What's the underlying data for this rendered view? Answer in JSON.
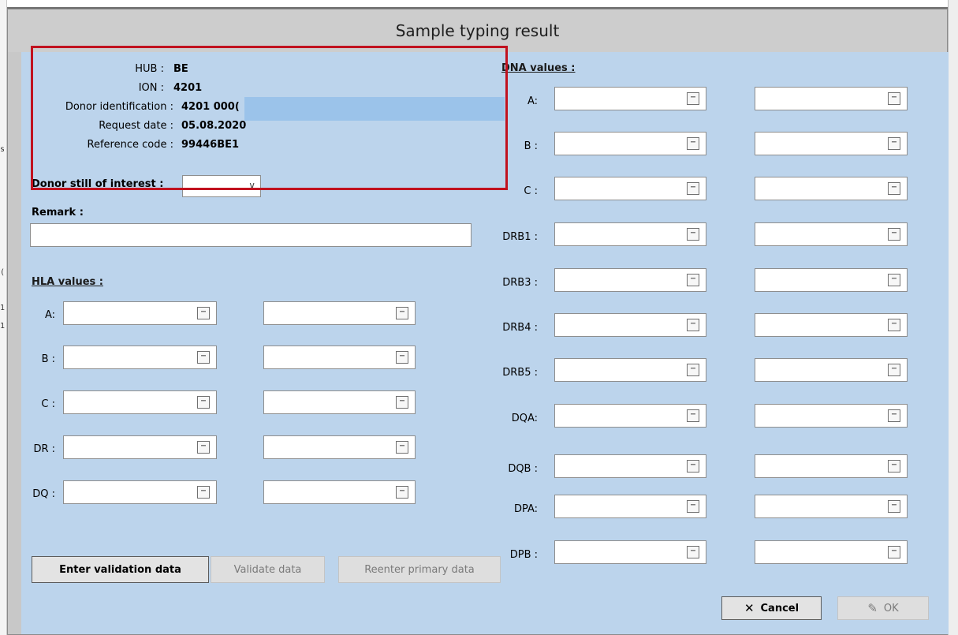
{
  "dialog": {
    "title": "Sample typing result"
  },
  "donor": {
    "hub_label": "HUB :",
    "hub_value": "BE",
    "ion_label": "ION :",
    "ion_value": "4201",
    "donor_id_label": "Donor identification :",
    "donor_id_value": "4201 000(",
    "request_date_label": "Request date :",
    "request_date_value": "05.08.2020",
    "reference_code_label": "Reference code :",
    "reference_code_value": "99446BE1",
    "still_interest_label": "Donor still of interest :",
    "still_interest_value": ""
  },
  "remark": {
    "label": "Remark :",
    "value": ""
  },
  "hla": {
    "title": "HLA values :",
    "rows": [
      {
        "label": "A:",
        "value1": "",
        "value2": ""
      },
      {
        "label": "B :",
        "value1": "",
        "value2": ""
      },
      {
        "label": "C :",
        "value1": "",
        "value2": ""
      },
      {
        "label": "DR :",
        "value1": "",
        "value2": ""
      },
      {
        "label": "DQ :",
        "value1": "",
        "value2": ""
      }
    ]
  },
  "dna": {
    "title": "DNA values :",
    "rows": [
      {
        "label": "A:",
        "value1": "",
        "value2": ""
      },
      {
        "label": "B :",
        "value1": "",
        "value2": ""
      },
      {
        "label": "C :",
        "value1": "",
        "value2": ""
      },
      {
        "label": "DRB1 :",
        "value1": "",
        "value2": ""
      },
      {
        "label": "DRB3 :",
        "value1": "",
        "value2": ""
      },
      {
        "label": "DRB4 :",
        "value1": "",
        "value2": ""
      },
      {
        "label": "DRB5 :",
        "value1": "",
        "value2": ""
      },
      {
        "label": "DQA:",
        "value1": "",
        "value2": ""
      },
      {
        "label": "DQB :",
        "value1": "",
        "value2": ""
      },
      {
        "label": "DPA:",
        "value1": "",
        "value2": ""
      },
      {
        "label": "DPB :",
        "value1": "",
        "value2": ""
      }
    ]
  },
  "picker_glyph": "⋯",
  "buttons": {
    "enter_validation": "Enter validation data",
    "validate": "Validate data",
    "reenter": "Reenter primary data",
    "cancel": "Cancel",
    "ok": "OK",
    "cancel_icon": "close-icon",
    "ok_icon": "edit-check-icon"
  },
  "annotation": {
    "color": "#c1121f"
  }
}
